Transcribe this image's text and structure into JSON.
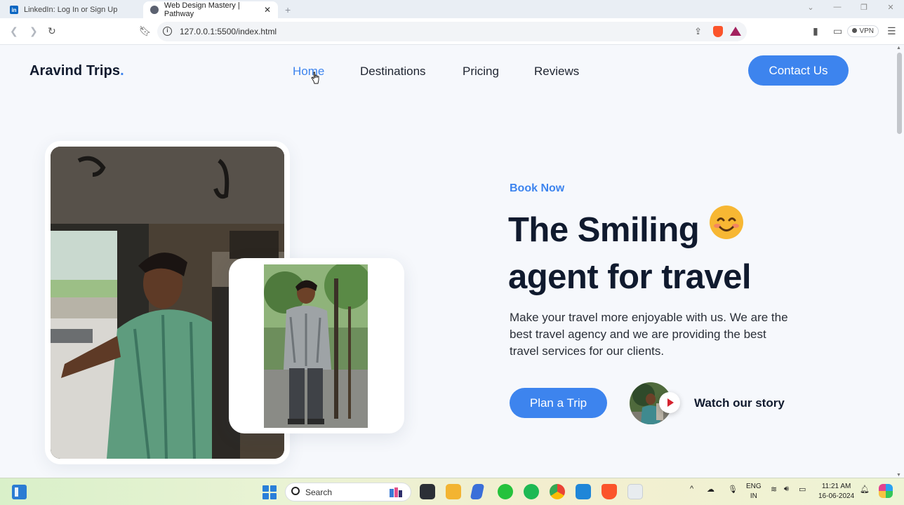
{
  "browser": {
    "tabs": [
      {
        "title": "LinkedIn: Log In or Sign Up",
        "active": false
      },
      {
        "title": "Web Design Mastery | Pathway",
        "active": true
      }
    ],
    "url": "127.0.0.1:5500/index.html",
    "vpn_label": "VPN"
  },
  "site": {
    "brand": "Aravind Trips",
    "brand_dot": ".",
    "nav": [
      "Home",
      "Destinations",
      "Pricing",
      "Reviews"
    ],
    "active_nav": "Home",
    "contact_label": "Contact Us"
  },
  "hero": {
    "eyebrow": "Book Now",
    "headline_line1": "The Smiling",
    "headline_line2": "agent for travel",
    "description": "Make your travel more enjoyable with us. We are the best travel agency and we are providing the best travel services for our clients.",
    "cta_label": "Plan a Trip",
    "story_label": "Watch our story"
  },
  "taskbar": {
    "search_placeholder": "Search",
    "lang_top": "ENG",
    "lang_bottom": "IN",
    "time": "11:21 AM",
    "date": "16-06-2024"
  },
  "colors": {
    "accent": "#3d84ee",
    "heading": "#101a2e",
    "page_bg": "#f6f8fc"
  }
}
